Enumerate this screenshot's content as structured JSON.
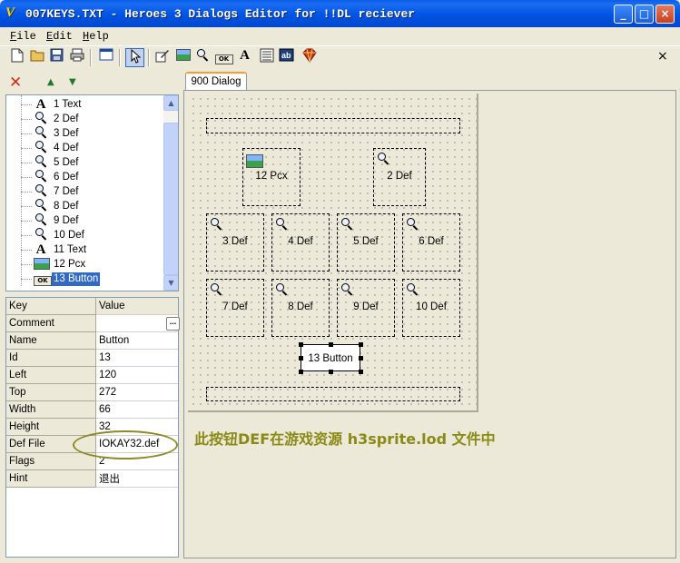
{
  "window": {
    "app_icon": "V",
    "title": "007KEYS.TXT - Heroes 3 Dialogs Editor for !!DL reciever",
    "min_label": "_",
    "max_label": "□",
    "close_label": "×"
  },
  "menu": {
    "items": [
      "File",
      "Edit",
      "Help"
    ]
  },
  "toolbar": {
    "icons": [
      "new-file-icon",
      "open-folder-icon",
      "save-icon",
      "print-icon",
      "dialog-window-icon",
      "pointer-icon",
      "edit-pen-icon",
      "pcx-image-icon",
      "def-magnifier-icon",
      "ok-button-icon",
      "text-a-icon",
      "list-icon",
      "textbox-ab-icon",
      "gem-icon"
    ],
    "close_label": "×"
  },
  "tree_tools": {
    "delete": "✕",
    "up": "▲",
    "down": "▼"
  },
  "tree": {
    "items": [
      {
        "label": "1  Text",
        "icon": "text"
      },
      {
        "label": "2  Def",
        "icon": "def"
      },
      {
        "label": "3  Def",
        "icon": "def"
      },
      {
        "label": "4  Def",
        "icon": "def"
      },
      {
        "label": "5  Def",
        "icon": "def"
      },
      {
        "label": "6  Def",
        "icon": "def"
      },
      {
        "label": "7  Def",
        "icon": "def"
      },
      {
        "label": "8  Def",
        "icon": "def"
      },
      {
        "label": "9  Def",
        "icon": "def"
      },
      {
        "label": "10  Def",
        "icon": "def"
      },
      {
        "label": "11  Text",
        "icon": "text"
      },
      {
        "label": "12  Pcx",
        "icon": "pcx"
      },
      {
        "label": "13  Button",
        "icon": "button",
        "selected": true
      }
    ],
    "scroll_up": "▲",
    "scroll_down": "▼"
  },
  "properties": {
    "header": {
      "key": "Key",
      "value": "Value"
    },
    "rows": [
      {
        "key": "Comment",
        "value": ""
      },
      {
        "key": "Name",
        "value": "Button"
      },
      {
        "key": "Id",
        "value": "13"
      },
      {
        "key": "Left",
        "value": "120"
      },
      {
        "key": "Top",
        "value": "272"
      },
      {
        "key": "Width",
        "value": "66"
      },
      {
        "key": "Height",
        "value": "32"
      },
      {
        "key": "Def File",
        "value": "IOKAY32.def"
      },
      {
        "key": "Flags",
        "value": "2"
      },
      {
        "key": "Hint",
        "value": "退出"
      }
    ],
    "ellipsis_label": "..."
  },
  "tabs": [
    {
      "label": "900 Dialog",
      "active": true
    }
  ],
  "canvas": {
    "pcx_label": "12  Pcx",
    "defs": [
      "2  Def",
      "3  Def",
      "4  Def",
      "5  Def",
      "6  Def",
      "7  Def",
      "8  Def",
      "9  Def",
      "10  Def"
    ],
    "button_label": "13  Button"
  },
  "caption": "此按钮DEF在游戏资源 h3sprite.lod 文件中"
}
